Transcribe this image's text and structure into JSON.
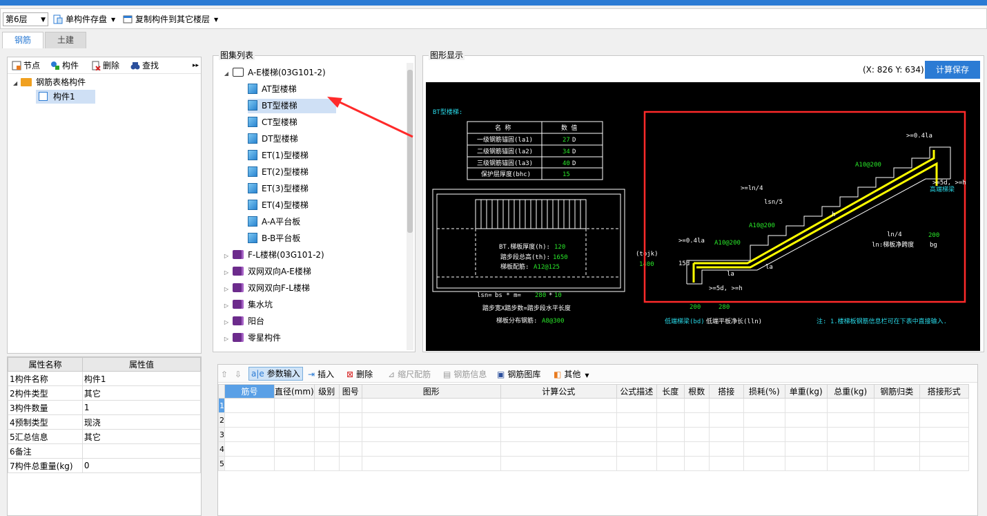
{
  "toolbar": {
    "floor": "第6层",
    "save_single": "单构件存盘",
    "copy_to_floor": "复制构件到其它楼层"
  },
  "tabs": [
    {
      "label": "钢筋",
      "active": true
    },
    {
      "label": "土建",
      "active": false
    }
  ],
  "left_tools": {
    "node": "节点",
    "component": "构件",
    "delete": "删除",
    "find": "查找"
  },
  "tree": {
    "root": "钢筋表格构件",
    "child": "构件1"
  },
  "props": {
    "headers": [
      "属性名称",
      "属性值"
    ],
    "rows": [
      {
        "no": "1",
        "name": "构件名称",
        "value": "构件1"
      },
      {
        "no": "2",
        "name": "构件类型",
        "value": "其它"
      },
      {
        "no": "3",
        "name": "构件数量",
        "value": "1"
      },
      {
        "no": "4",
        "name": "预制类型",
        "value": "现浇"
      },
      {
        "no": "5",
        "name": "汇总信息",
        "value": "其它"
      },
      {
        "no": "6",
        "name": "备注",
        "value": ""
      },
      {
        "no": "7",
        "name": "构件总重量(kg)",
        "value": "0"
      }
    ]
  },
  "atlas": {
    "title": "图集列表",
    "root": "A-E楼梯(03G101-2)",
    "children": [
      "AT型楼梯",
      "BT型楼梯",
      "CT型楼梯",
      "DT型楼梯",
      "ET(1)型楼梯",
      "ET(2)型楼梯",
      "ET(3)型楼梯",
      "ET(4)型楼梯",
      "A-A平台板",
      "B-B平台板"
    ],
    "selected": "BT型楼梯",
    "others": [
      "F-L楼梯(03G101-2)",
      "双网双向A-E楼梯",
      "双网双向F-L楼梯",
      "集水坑",
      "阳台",
      "零星构件"
    ]
  },
  "graph": {
    "title": "图形显示",
    "coords": "(X: 826 Y: 634)",
    "calc_save": "计算保存",
    "drawing": {
      "name": "BT型楼梯:",
      "table_head": [
        "名 称",
        "数 值"
      ],
      "table_rows": [
        {
          "name": "一级钢筋锚固(la1)",
          "value": "27",
          "unit": "D"
        },
        {
          "name": "二级钢筋锚固(la2)",
          "value": "34",
          "unit": "D"
        },
        {
          "name": "三级钢筋锚固(la3)",
          "value": "40",
          "unit": "D"
        },
        {
          "name": "保护层厚度(bhc)",
          "value": "15",
          "unit": ""
        }
      ],
      "plan_h": "BT.梯板厚度(h):",
      "plan_h_val": "120",
      "plan_th": "踏步段总高(th):",
      "plan_th_val": "1650",
      "plan_rebar": "梯板配筋:",
      "plan_rebar_val": "A12@125",
      "lsn_a": "lsn=",
      "lsn_b": "bs * m=",
      "lsn_val1": "280",
      "lsn_mul": "*",
      "lsn_val2": "10",
      "step_desc": "踏步宽X踏步数=踏步段水平长度",
      "dist_rebar": "梯板分布钢筋:",
      "dist_rebar_val": "A8@300",
      "tojk": "(tojk)",
      "h1400": "1400",
      "s_04la_top": ">=0.4la",
      "s_ln4_top": ">=ln/4",
      "s_lsn5": "lsn/5",
      "s_a10_right": "A10@200",
      "s_a10_mid": "A10@200",
      "s_a10_left": "A10@200",
      "s_04la_left": ">=0.4la",
      "s_15d": "15d",
      "s_la1": "la",
      "s_la2": "la",
      "s_5dh_bot": ">=5d, >=h",
      "s_5dh_right": ">=5d, >=h",
      "s_h": "h",
      "s_ln4": "ln/4",
      "s_200r": "200",
      "s_bg": "bg",
      "s_ln_desc": "ln:梯板净跨度",
      "s_high_beam": "高端梯梁",
      "b_200": "200",
      "b_280": "280",
      "b_low": "低端梯梁(bd)",
      "b_span": "低端平板净长(lln)",
      "note": "注: 1.楼梯板钢筋信息栏可在下表中直接输入."
    }
  },
  "bottom_tools": {
    "param_input": "参数输入",
    "insert": "插入",
    "delete": "删除",
    "scale_rebar": "缩尺配筋",
    "rebar_info": "钢筋信息",
    "rebar_lib": "钢筋图库",
    "other": "其他"
  },
  "grid": {
    "headers": [
      "筋号",
      "直径(mm)",
      "级别",
      "图号",
      "图形",
      "计算公式",
      "公式描述",
      "长度",
      "根数",
      "搭接",
      "损耗(%)",
      "单重(kg)",
      "总重(kg)",
      "钢筋归类",
      "搭接形式"
    ],
    "rows": [
      "1",
      "2",
      "3",
      "4",
      "5"
    ]
  },
  "colors": {
    "accent": "#2b7bd4",
    "cad_bg": "#000000",
    "cad_rebar": "#ffff00",
    "cad_text_green": "#29e829",
    "highlight_box": "#ff2a2a"
  }
}
